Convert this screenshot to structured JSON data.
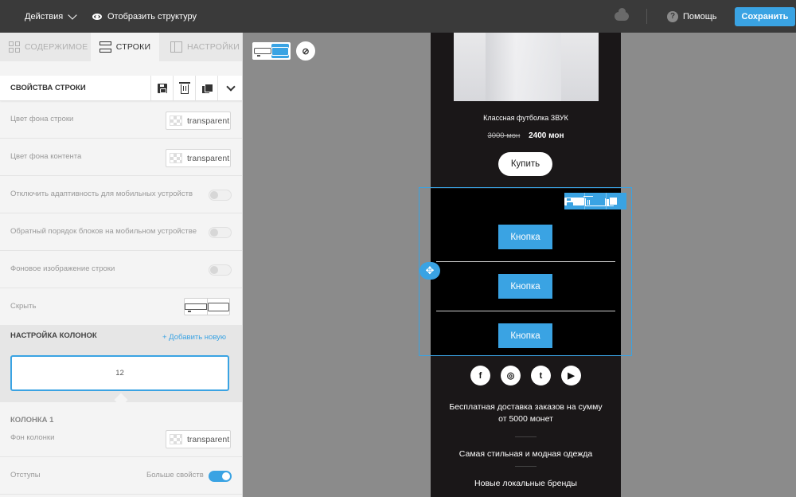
{
  "topbar": {
    "actions_label": "Действия",
    "structure_label": "Отобразить структуру",
    "help_label": "Помощь",
    "save_label": "Сохранить"
  },
  "tabs": [
    {
      "label": "СОДЕРЖИМОЕ",
      "icon": "grid-icon",
      "active": false
    },
    {
      "label": "СТРОКИ",
      "icon": "rows-icon",
      "active": true
    },
    {
      "label": "НАСТРОЙКИ",
      "icon": "settings-icon",
      "active": false
    }
  ],
  "row_props": {
    "title": "СВОЙСТВА СТРОКИ",
    "items": [
      {
        "label": "Цвет фона строки",
        "value": "transparent"
      },
      {
        "label": "Цвет фона контента",
        "value": "transparent"
      },
      {
        "label": "Отключить адаптивность для мобильных устройств"
      },
      {
        "label": "Обратный порядок блоков на мобильном устройстве"
      },
      {
        "label": "Фоновое изображение строки"
      },
      {
        "label": "Скрыть"
      }
    ]
  },
  "columns": {
    "title": "НАСТРОЙКА КОЛОНОК",
    "add_label": "+ Добавить новую",
    "column_width": "12",
    "column1_title": "КОЛОНКА 1",
    "bg_label": "Фон колонки",
    "bg_value": "transparent",
    "padding_label": "Отступы",
    "more_label": "Больше свойств"
  },
  "email": {
    "product_name": "Классная футболка ЗВУК",
    "old_price": "3000 мон",
    "new_price": "2400 мон",
    "buy_label": "Купить",
    "buttons": [
      "Кнопка",
      "Кнопка",
      "Кнопка"
    ],
    "socials": [
      "f",
      "◎",
      "t",
      "▶"
    ],
    "footer": [
      "Бесплатная доставка заказов на сумму от 5000 монет",
      "Самая стильная и модная одежда",
      "Новые локальные бренды"
    ]
  },
  "colors": {
    "accent": "#3aa3e3",
    "topbar": "#3a3a3a",
    "email_bg": "#1a1718"
  }
}
